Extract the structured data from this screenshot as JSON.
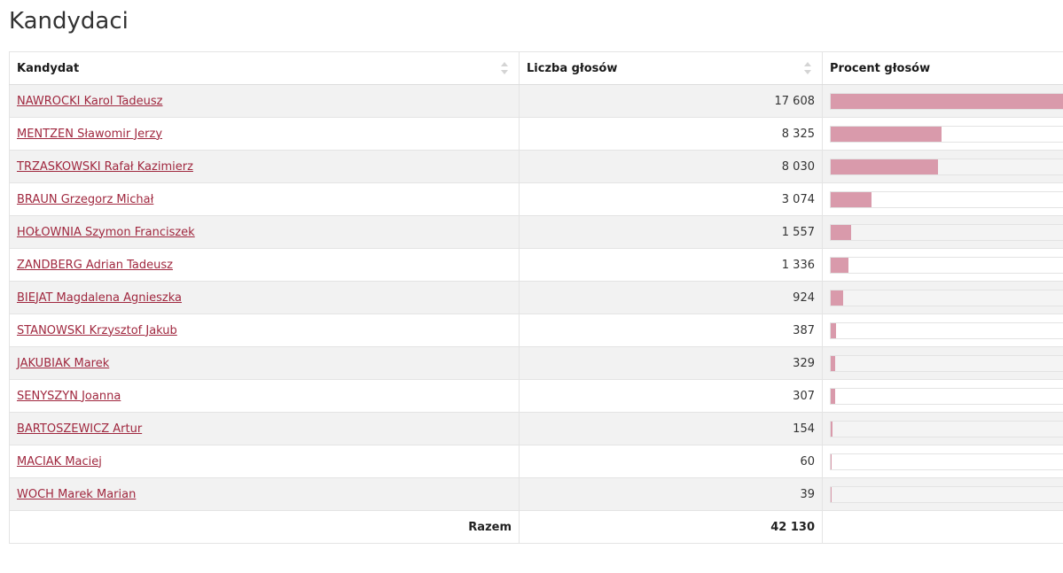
{
  "page": {
    "title": "Kandydaci"
  },
  "table": {
    "headers": {
      "candidate": "Kandydat",
      "votes": "Liczba głosów",
      "percent": "Procent głosów"
    },
    "rows": [
      {
        "name": "NAWROCKI Karol Tadeusz",
        "votes": "17 608",
        "votes_num": 17608
      },
      {
        "name": "MENTZEN Sławomir Jerzy",
        "votes": "8 325",
        "votes_num": 8325
      },
      {
        "name": "TRZASKOWSKI Rafał Kazimierz",
        "votes": "8 030",
        "votes_num": 8030
      },
      {
        "name": "BRAUN Grzegorz Michał",
        "votes": "3 074",
        "votes_num": 3074
      },
      {
        "name": "HOŁOWNIA Szymon Franciszek",
        "votes": "1 557",
        "votes_num": 1557
      },
      {
        "name": "ZANDBERG Adrian Tadeusz",
        "votes": "1 336",
        "votes_num": 1336
      },
      {
        "name": "BIEJAT Magdalena Agnieszka",
        "votes": "924",
        "votes_num": 924
      },
      {
        "name": "STANOWSKI Krzysztof Jakub",
        "votes": "387",
        "votes_num": 387
      },
      {
        "name": "JAKUBIAK Marek",
        "votes": "329",
        "votes_num": 329
      },
      {
        "name": "SENYSZYN Joanna",
        "votes": "307",
        "votes_num": 307
      },
      {
        "name": "BARTOSZEWICZ Artur",
        "votes": "154",
        "votes_num": 154
      },
      {
        "name": "MACIAK Maciej",
        "votes": "60",
        "votes_num": 60
      },
      {
        "name": "WOCH Marek Marian",
        "votes": "39",
        "votes_num": 39
      }
    ],
    "footer": {
      "label": "Razem",
      "total": "42 130",
      "total_num": 42130
    }
  },
  "colors": {
    "link": "#a0283f",
    "bar_fill": "#d99aab",
    "row_stripe": "#f2f2f2"
  },
  "icons": {
    "sort": "sort-icon"
  }
}
